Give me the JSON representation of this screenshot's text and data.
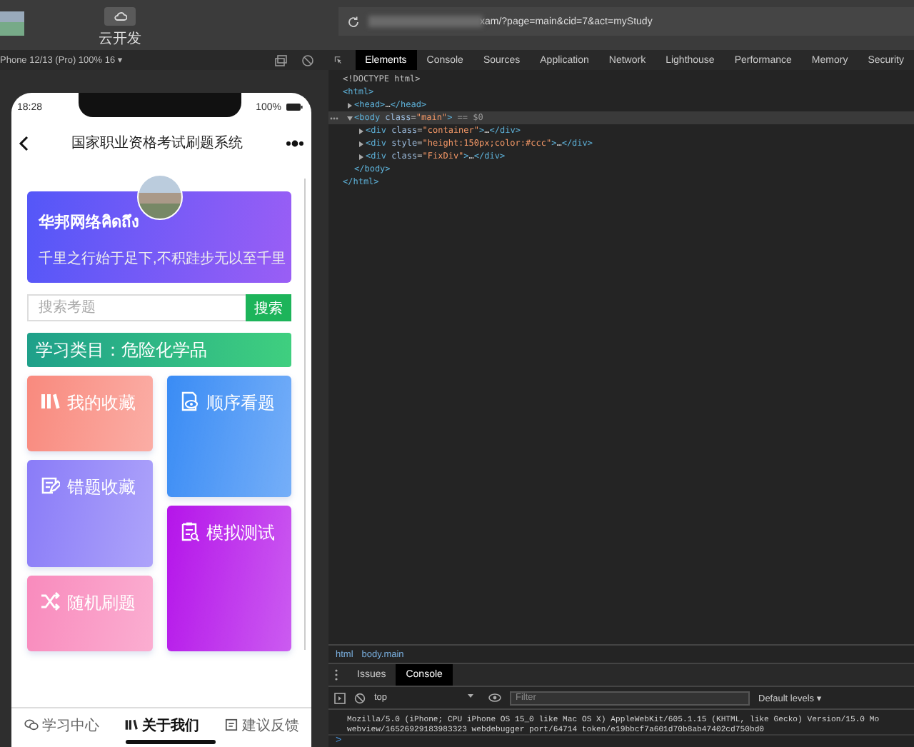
{
  "browser": {
    "toolbar_button": "云开发",
    "url": "xam/?page=main&cid=7&act=myStudy",
    "device": "Phone 12/13 (Pro) 100% 16 ▾"
  },
  "phone": {
    "time": "18:28",
    "battery": "100%",
    "title": "国家职业资格考试刷题系统",
    "banner": {
      "title": "华邦网络คิดถึง",
      "motto": "千里之行始于足下,不积跬步无以至千里"
    },
    "search": {
      "placeholder": "搜索考题",
      "button": "搜索"
    },
    "category": "学习类目：危险化学品",
    "tile_columns": [
      [
        {
          "label": "我的收藏",
          "color": "#f98a7e"
        },
        {
          "label": "错题收藏",
          "color": "#8a7cf8"
        },
        {
          "label": "随机刷题",
          "color": "#f98bbd"
        }
      ],
      [
        {
          "label": "顺序看题",
          "color": "#3a8cf5"
        },
        {
          "label": "模拟测试",
          "color": "#b515ea"
        }
      ]
    ],
    "tabs": [
      {
        "label": "学习中心",
        "selected": false
      },
      {
        "label": "关于我们",
        "selected": true
      },
      {
        "label": "建议反馈",
        "selected": false
      }
    ]
  },
  "devtools": {
    "tabs": [
      {
        "label": "Elements",
        "selected": true
      },
      {
        "label": "Console",
        "selected": false
      },
      {
        "label": "Sources",
        "selected": false
      },
      {
        "label": "Application",
        "selected": false
      },
      {
        "label": "Network",
        "selected": false
      },
      {
        "label": "Lighthouse",
        "selected": false
      },
      {
        "label": "Performance",
        "selected": false
      },
      {
        "label": "Memory",
        "selected": false
      },
      {
        "label": "Security",
        "selected": false
      }
    ],
    "dom": [
      {
        "selected": false,
        "parts": [
          {
            "kind": "doctype",
            "t": "<!DOCTYPE html>"
          }
        ]
      },
      {
        "selected": false,
        "parts": [
          {
            "kind": "tag",
            "t": "<html>"
          }
        ],
        "close": [
          {
            "kind": "tag",
            "t": "</html>"
          }
        ],
        "children": [
          {
            "expanded": false,
            "selected": false,
            "parts": [
              {
                "kind": "tag",
                "t": "<head>"
              },
              {
                "kind": "text",
                "t": "…"
              },
              {
                "kind": "tag",
                "t": "</head>"
              }
            ]
          },
          {
            "expanded": true,
            "selected": true,
            "parts": [
              {
                "kind": "tag",
                "t": "<body"
              },
              {
                "kind": "attr",
                "t": " class"
              },
              {
                "kind": "punc",
                "t": "="
              },
              {
                "kind": "val",
                "t": "\"main\""
              },
              {
                "kind": "tag",
                "t": ">"
              },
              {
                "kind": "note",
                "t": " == $0"
              }
            ],
            "close": [
              {
                "kind": "tag",
                "t": "</body>"
              }
            ],
            "children": [
              {
                "expanded": false,
                "selected": false,
                "parts": [
                  {
                    "kind": "tag",
                    "t": "<div"
                  },
                  {
                    "kind": "attr",
                    "t": " class"
                  },
                  {
                    "kind": "punc",
                    "t": "="
                  },
                  {
                    "kind": "val",
                    "t": "\"container\""
                  },
                  {
                    "kind": "tag",
                    "t": ">"
                  },
                  {
                    "kind": "text",
                    "t": "…"
                  },
                  {
                    "kind": "tag",
                    "t": "</div>"
                  }
                ]
              },
              {
                "expanded": false,
                "selected": false,
                "parts": [
                  {
                    "kind": "tag",
                    "t": "<div"
                  },
                  {
                    "kind": "attr",
                    "t": " style"
                  },
                  {
                    "kind": "punc",
                    "t": "="
                  },
                  {
                    "kind": "val",
                    "t": "\"height:150px;color:#ccc\""
                  },
                  {
                    "kind": "tag",
                    "t": ">"
                  },
                  {
                    "kind": "text",
                    "t": "…"
                  },
                  {
                    "kind": "tag",
                    "t": "</div>"
                  }
                ]
              },
              {
                "expanded": false,
                "selected": false,
                "parts": [
                  {
                    "kind": "tag",
                    "t": "<div"
                  },
                  {
                    "kind": "attr",
                    "t": " class"
                  },
                  {
                    "kind": "punc",
                    "t": "="
                  },
                  {
                    "kind": "val",
                    "t": "\"FixDiv\""
                  },
                  {
                    "kind": "tag",
                    "t": ">"
                  },
                  {
                    "kind": "text",
                    "t": "…"
                  },
                  {
                    "kind": "tag",
                    "t": "</div>"
                  }
                ]
              }
            ]
          }
        ]
      }
    ],
    "breadcrumbs": [
      "html",
      "body.main"
    ],
    "drawer_tabs": [
      {
        "label": "Issues",
        "selected": false
      },
      {
        "label": "Console",
        "selected": true
      }
    ],
    "context": "top",
    "filter_placeholder": "Filter",
    "levels": "Default levels ▾",
    "log": [
      "Mozilla/5.0 (iPhone; CPU iPhone OS 15_0 like Mac OS X) AppleWebKit/605.1.15 (KHTML, like Gecko) Version/15.0 Mo",
      "webview/16526929183983323 webdebugger port/64714 token/e19bbcf7a601d70b8ab47402cd750bd0"
    ],
    "prompt": ">"
  }
}
